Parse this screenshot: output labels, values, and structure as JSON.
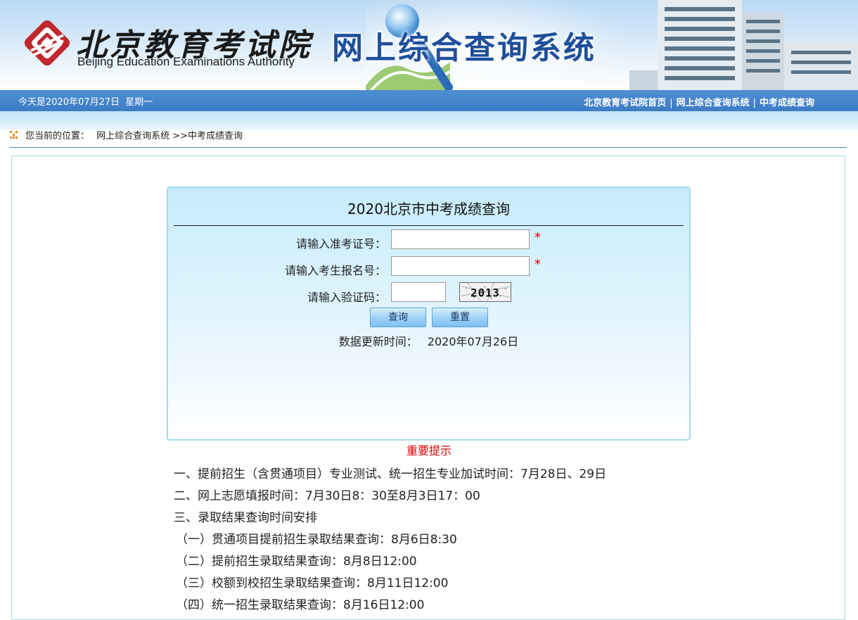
{
  "banner": {
    "org_cn": "北京教育考试院",
    "org_en": "Beijing Education Examinations Authority",
    "system_title": "网上综合查询系统"
  },
  "navbar": {
    "date": "今天是2020年07月27日",
    "weekday": "星期一",
    "links": [
      "北京教育考试院首页",
      "网上综合查询系统",
      "中考成绩查询"
    ],
    "separator": "|"
  },
  "breadcrumb": {
    "label": "您当前的位置：",
    "home": "网上综合查询系统",
    "current": ">>中考成绩查询"
  },
  "query": {
    "title": "2020北京市中考成绩查询",
    "exam_id_label": "请输入准考证号：",
    "exam_id_value": "",
    "reg_no_label": "请输入考生报名号：",
    "reg_no_value": "",
    "captcha_label": "请输入验证码：",
    "captcha_value": "",
    "captcha_image_text": "2013",
    "required_mark": "*",
    "submit_label": "查询",
    "reset_label": "重置",
    "update_label": "数据更新时间：",
    "update_value": "2020年07月26日"
  },
  "notice": {
    "title": "重要提示",
    "lines": [
      "一、提前招生（含贯通项目）专业测试、统一招生专业加试时间：7月28日、29日",
      "二、网上志愿填报时间：7月30日8：30至8月3日17：00",
      "三、录取结果查询时间安排",
      "（一）贯通项目提前招生录取结果查询：8月6日8:30",
      "（二）提前招生录取结果查询：8月8日12:00",
      "（三）校额到校招生录取结果查询：8月11日12:00",
      "（四）统一招生录取结果查询：8月16日12:00"
    ]
  },
  "colors": {
    "nav_blue": "#3d7cc5",
    "title_blue": "#1f4f9c",
    "logo_red": "#c0282d",
    "required_red": "#e00000",
    "notice_red": "#e00000"
  }
}
